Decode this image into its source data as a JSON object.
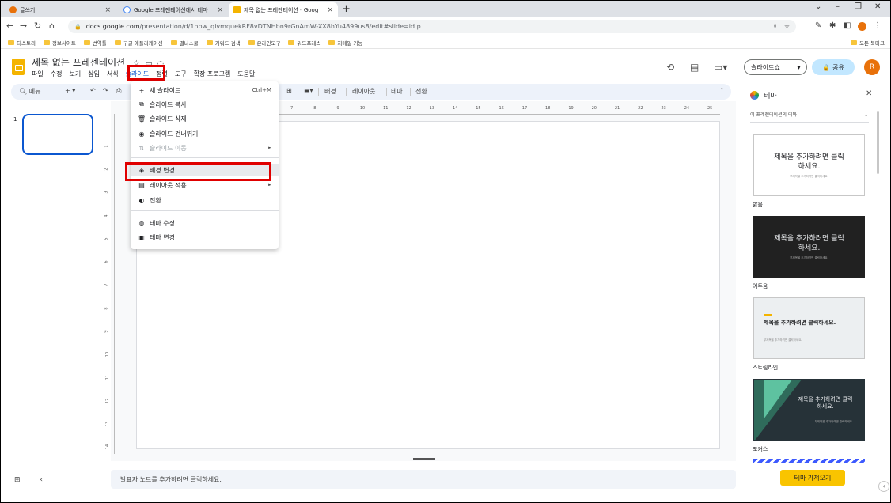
{
  "browser": {
    "tabs": [
      {
        "title": "글쓰기",
        "favicon_color": "#e8710a"
      },
      {
        "title": "Google 프레젠테이션에서 테마",
        "favicon_color": "#4285f4"
      },
      {
        "title": "제목 없는 프레젠테이션 - Goog",
        "favicon_color": "#f4b400"
      }
    ],
    "url_domain": "docs.google.com",
    "url_path": "/presentation/d/1hbw_qivmquekRF8vDTNHbn9rGnAmW-XX8hYu4899us8/edit#slide=id.p",
    "bookmarks": [
      "티스토리",
      "정보사이트",
      "번역툴",
      "구글 애플리케이션",
      "별나스쿨",
      "키워드 검색",
      "온라인도구",
      "워드프레스",
      "지메일 기능"
    ],
    "all_bookmarks": "모든 북마크"
  },
  "doc": {
    "title": "제목 없는 프레젠테이션",
    "menus": [
      "파일",
      "수정",
      "보기",
      "삽입",
      "서식",
      "슬라이드",
      "정렬",
      "도구",
      "확장 프로그램",
      "도움말"
    ]
  },
  "header": {
    "slideshow_label": "슬라이드쇼",
    "share_label": "공유",
    "avatar_initial": "R"
  },
  "toolbar": {
    "menu_label": "메뉴",
    "background_label": "배경",
    "layout_label": "레이아웃",
    "theme_label": "테마",
    "transition_label": "전환"
  },
  "ruler": {
    "h_ticks": [
      "7",
      "8",
      "9",
      "10",
      "11",
      "12",
      "13",
      "14",
      "15",
      "16",
      "17",
      "18",
      "19",
      "20",
      "21",
      "22",
      "23",
      "24",
      "25"
    ],
    "v_ticks": [
      "1",
      "2",
      "3",
      "4",
      "5",
      "6",
      "7",
      "8",
      "9",
      "10",
      "11",
      "12",
      "13",
      "14"
    ]
  },
  "filmstrip": {
    "slide_number": "1"
  },
  "slide_menu": {
    "items": [
      {
        "icon": "+",
        "label": "새 슬라이드",
        "shortcut": "Ctrl+M"
      },
      {
        "icon": "⧉",
        "label": "슬라이드 복사",
        "shortcut": ""
      },
      {
        "icon": "🗑",
        "label": "슬라이드 삭제",
        "shortcut": ""
      },
      {
        "icon": "◉",
        "label": "슬라이드 건너뛰기",
        "shortcut": ""
      },
      {
        "icon": "⇅",
        "label": "슬라이드 이동",
        "shortcut": "►"
      },
      {
        "icon": "◈",
        "label": "배경 변경",
        "shortcut": ""
      },
      {
        "icon": "▤",
        "label": "레이아웃 적용",
        "shortcut": "►"
      },
      {
        "icon": "◐",
        "label": "전환",
        "shortcut": ""
      },
      {
        "icon": "◍",
        "label": "테마 수정",
        "shortcut": ""
      },
      {
        "icon": "▣",
        "label": "테마 변경",
        "shortcut": ""
      }
    ]
  },
  "notes": {
    "placeholder": "발표자 노트를 추가하려면 클릭하세요."
  },
  "theme_panel": {
    "title": "테마",
    "subtitle": "이 프레젠테이션의 테마",
    "themes": [
      {
        "name": "밝음",
        "title_text": "제목을 추가하려면 클릭하세요.",
        "sub_text": "부제목을 추가하려면 클릭하세요."
      },
      {
        "name": "어두움",
        "title_text": "제목을 추가하려면 클릭하세요.",
        "sub_text": "부제목을 추가하려면 클릭하세요."
      },
      {
        "name": "스트림라인",
        "title_text": "제목을 추가하려면 클릭하세요.",
        "sub_text": "부제목을 추가하려면 클릭하세요."
      },
      {
        "name": "포커스",
        "title_text": "제목을 추가하려면 클릭하세요.",
        "sub_text": "부제목을 추가하려면 클릭하세요."
      }
    ],
    "import_label": "테마 가져오기"
  },
  "colors": {
    "accent_yellow": "#f9c400",
    "highlight_red": "#e00000",
    "selection_blue": "#0b57d0"
  }
}
